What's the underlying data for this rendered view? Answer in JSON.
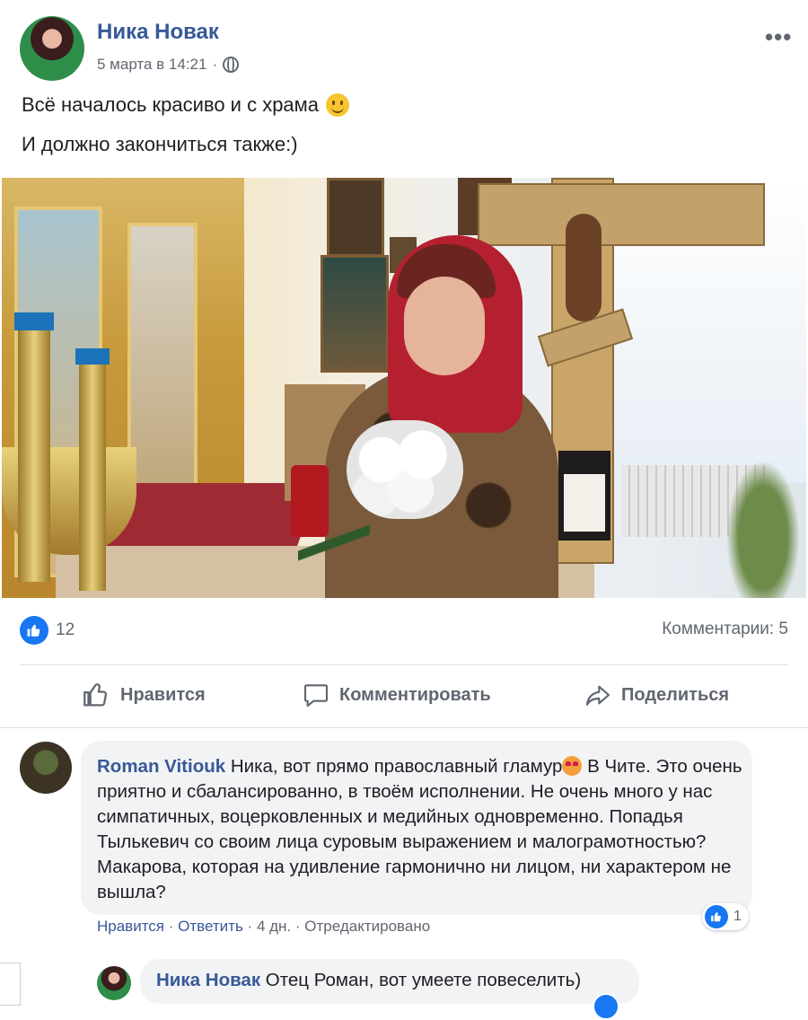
{
  "post": {
    "author": "Ника Новак",
    "timestamp": "5 марта в 14:21",
    "text_line1": "Всё началось красиво и с храма",
    "text_line2": "И должно закончиться также:)",
    "more_label": "•••"
  },
  "stats": {
    "likes": "12",
    "comments": "Комментарии: 5"
  },
  "actions": {
    "like": "Нравится",
    "comment": "Комментировать",
    "share": "Поделиться"
  },
  "comments": [
    {
      "author": "Roman Vitiouk",
      "text_before_emoji": "Ника, вот прямо православный гламур",
      "text_after_emoji": " В Чите. Это очень приятно и сбалансированно, в твоём исполнении. Не очень много у нас симпатичных, воцерковленных и медийных одновременно. Попадья Тылькевич со своим лица суровым выражением и малограмотностью? Макарова, которая на удивление гармонично ни лицом, ни характером не вышла?",
      "like_action": "Нравится",
      "reply_action": "Ответить",
      "age": "4 дн.",
      "edited": "Отредактировано",
      "reaction_count": "1"
    }
  ],
  "reply": {
    "author": "Ника Новак",
    "text": "Отец Роман, вот умеете повеселить)"
  },
  "colors": {
    "link": "#385898",
    "like_blue": "#1877f2",
    "muted": "#606770",
    "bubble": "#f2f3f5"
  }
}
